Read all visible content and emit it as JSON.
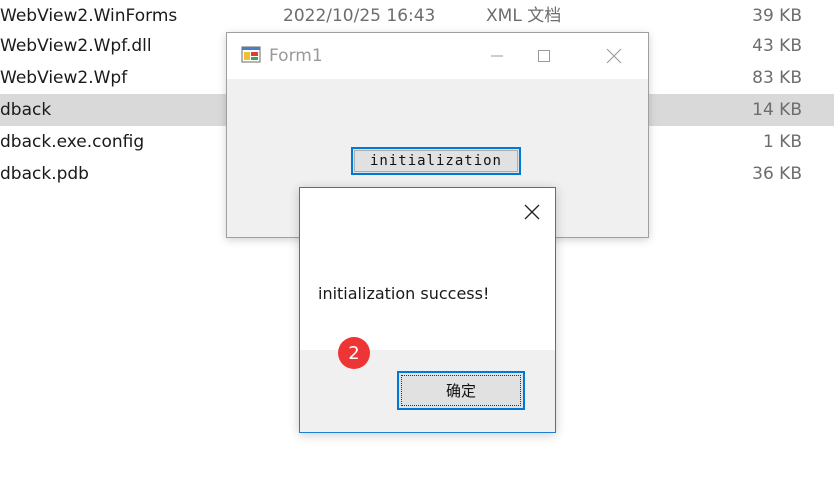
{
  "file_list": {
    "rows": [
      {
        "name": "WebView2.WinForms",
        "date": "2022/10/25 16:43",
        "type": "XML 文档",
        "size": "39 KB"
      },
      {
        "name": "WebView2.Wpf.dll",
        "size": "43 KB"
      },
      {
        "name": "WebView2.Wpf",
        "size": "83 KB"
      },
      {
        "name": "dback",
        "size": "14 KB"
      },
      {
        "name": "dback.exe.config",
        "size": "1 KB"
      },
      {
        "name": "dback.pdb",
        "size": "36 KB"
      }
    ]
  },
  "form1": {
    "title": "Form1",
    "init_button_label": "initialization"
  },
  "message_box": {
    "message": "initialization success!",
    "ok_label": "确定",
    "badge_number": "2"
  },
  "colors": {
    "accent": "#0078d7",
    "badge": "#ee3535",
    "selected_row": "#d9d9d9"
  }
}
